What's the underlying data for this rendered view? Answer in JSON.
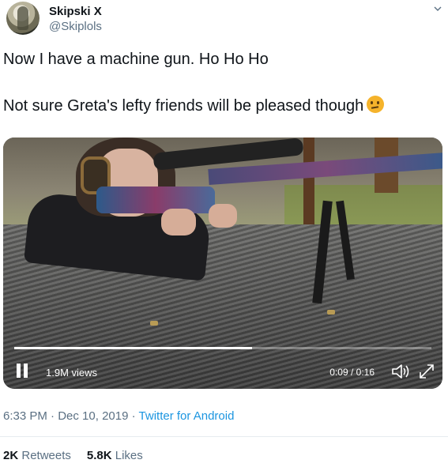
{
  "user": {
    "display_name": "Skipski X",
    "handle": "@Skiplols"
  },
  "tweet": {
    "line1": "Now I have a machine gun. Ho Ho Ho",
    "line2": "Not sure Greta's lefty friends will be pleased though",
    "emoji_icon": "thinking-face-emoji"
  },
  "video": {
    "views": "1.9M views",
    "time": "0:09 / 0:16",
    "progress": 0.57
  },
  "meta": {
    "time": "6:33 PM",
    "separator": "·",
    "date": "Dec 10, 2019",
    "source": "Twitter for Android"
  },
  "stats": {
    "retweets_count": "2K",
    "retweets_label": "Retweets",
    "likes_count": "5.8K",
    "likes_label": "Likes"
  },
  "colors": {
    "link": "#1b95e0",
    "secondary_text": "#5b7083"
  }
}
